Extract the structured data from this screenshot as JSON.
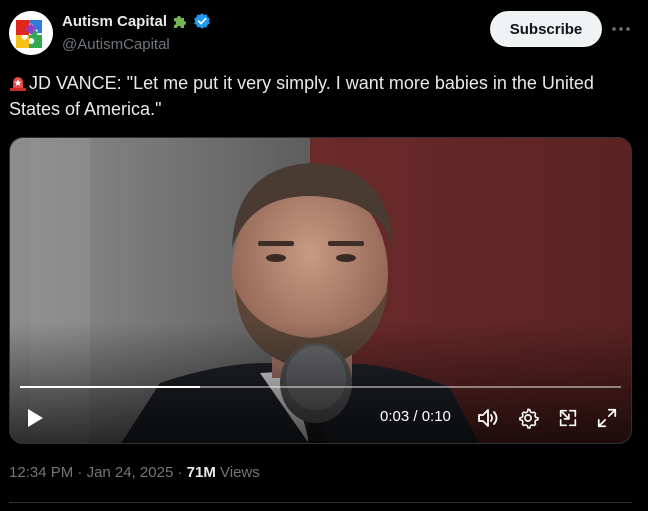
{
  "author": {
    "name": "Autism Capital",
    "handle": "@AutismCapital",
    "avatar_icon": "rainbow-puzzle-icon",
    "badge_icon": "green-puzzle-piece-icon",
    "verified_icon": "verified-badge-icon"
  },
  "subscribe_label": "Subscribe",
  "more_icon": "more-horizontal-icon",
  "tweet": {
    "emoji_icon": "rotating-siren-icon",
    "text": "JD VANCE: \"Let me put it very simply. I want more babies in the United States of America.\""
  },
  "video": {
    "current_time": "0:03",
    "duration": "0:10",
    "time_display": "0:03 / 0:10",
    "progress": 0.3,
    "controls": [
      "play-icon",
      "volume-icon",
      "settings-icon",
      "picture-in-picture-icon",
      "fullscreen-icon"
    ]
  },
  "meta": {
    "time": "12:34 PM",
    "date": "Jan 24, 2025",
    "separator": "·",
    "views_count": "71M",
    "views_label": "Views"
  },
  "colors": {
    "background": "#000000",
    "text": "#e7e9ea",
    "muted": "#71767b",
    "verified": "#1d9bf0",
    "subscribe_bg": "#eff3f4"
  }
}
